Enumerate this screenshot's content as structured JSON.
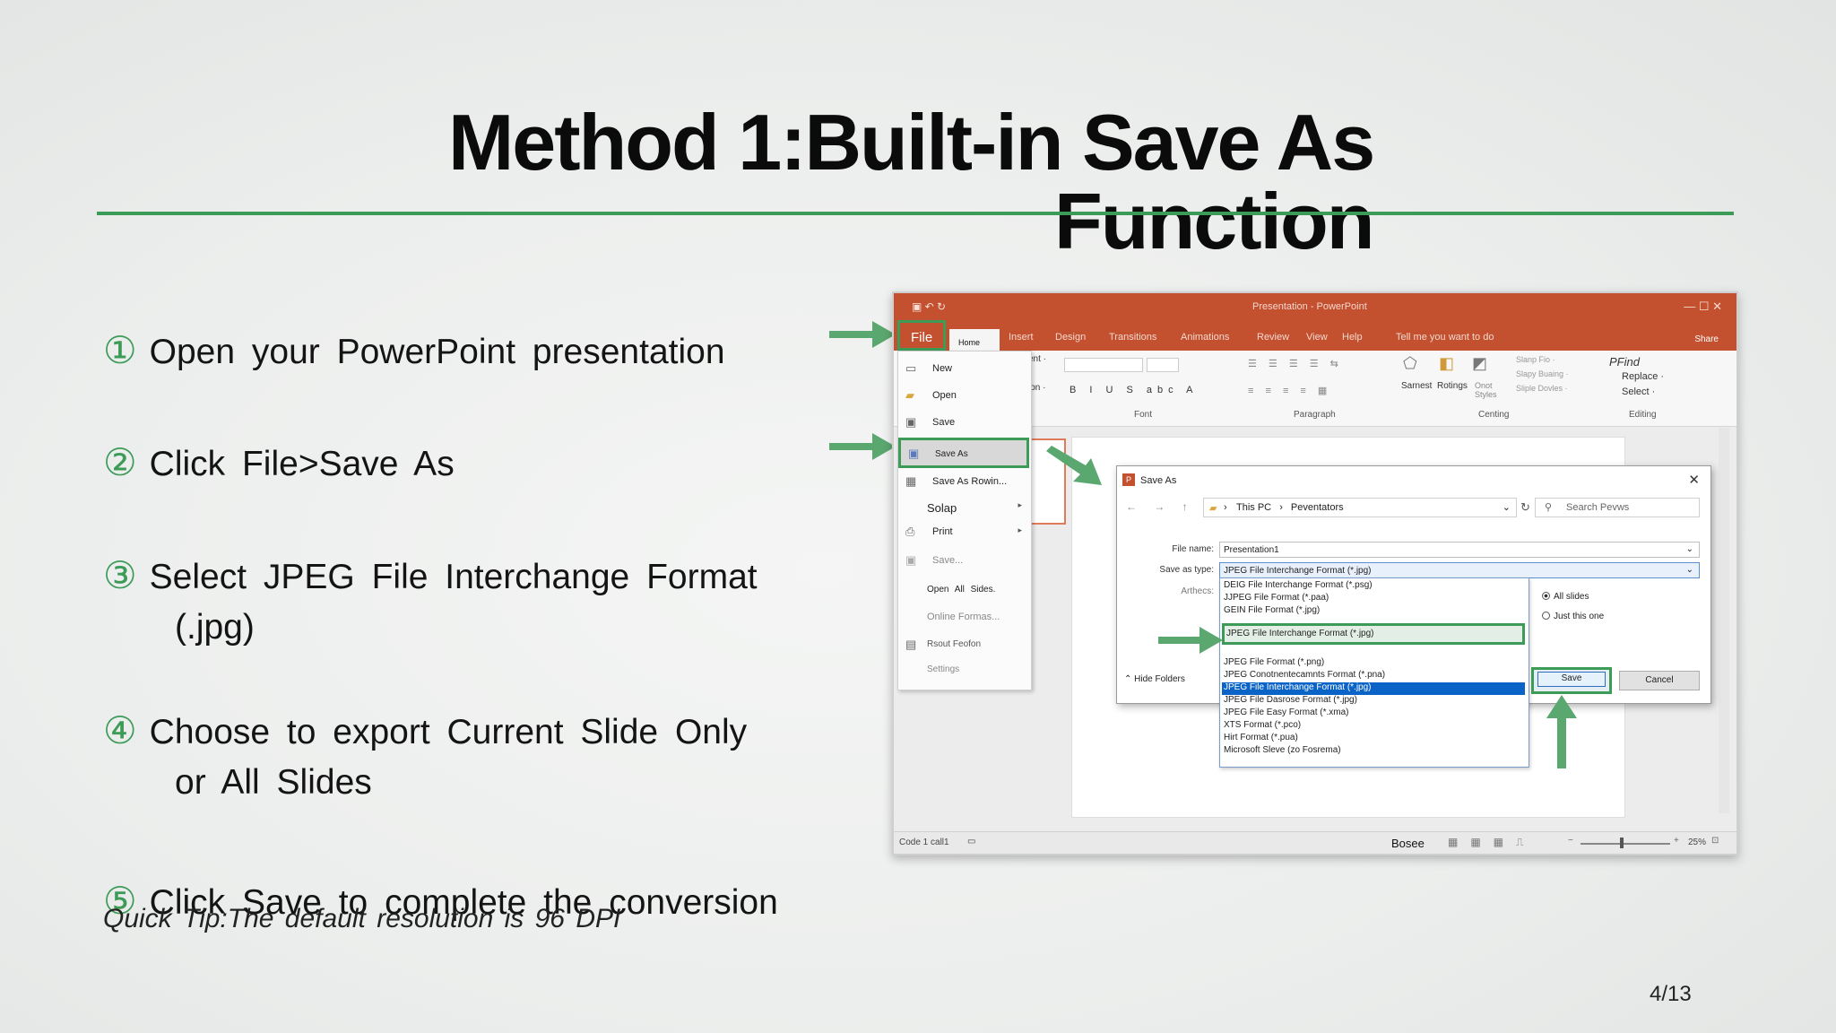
{
  "slide": {
    "title_line1": "Method 1:Built-in Save As",
    "title_line2": "Function",
    "steps": [
      {
        "num": "①",
        "text": "Open your PowerPoint presentation",
        "cont": ""
      },
      {
        "num": "②",
        "text": "Click File>Save As",
        "cont": ""
      },
      {
        "num": "③",
        "text": "Select JPEG File Interchange Format",
        "cont": "(.jpg)"
      },
      {
        "num": "④",
        "text": "Choose to export Current Slide Only",
        "cont": "or All Slides"
      },
      {
        "num": "⑤",
        "text": "Click Save to complete the conversion",
        "cont": ""
      }
    ],
    "tip": "Quick Tip:The default resolution is 96 DPI",
    "page": "4/13",
    "accent_color": "#3d9b58"
  },
  "screenshot": {
    "window_title": "Presentation - PowerPoint",
    "tabs": [
      "Insert",
      "Design",
      "Transitions",
      "Animations",
      "Review",
      "View",
      "Help",
      "Tell me you want to do"
    ],
    "file_tab": "File",
    "home_tab": "Home",
    "share": "Share",
    "ribbon_groups": [
      "Font",
      "Paragraph",
      "Centing",
      "Editing"
    ],
    "ribbon_left": [
      "ent ·",
      "t",
      "ion ·"
    ],
    "drawing_labels": [
      "Sarnest",
      "Rotings",
      "Onot Styles"
    ],
    "quick_styles": [
      "Slanp Fio ·",
      "Slapy Buaing ·",
      "Sliple Dovles ·"
    ],
    "editing_items": [
      "PFind",
      "Replace ·",
      "Select ·"
    ],
    "file_menu": [
      {
        "label": "New",
        "icon": "new-icon"
      },
      {
        "label": "Open",
        "icon": "open-icon"
      },
      {
        "label": "Save",
        "icon": "save-icon"
      },
      {
        "label": "Save As",
        "icon": "save-as-icon"
      },
      {
        "label": "Save As Rowin...",
        "icon": "save-as-icon"
      },
      {
        "label": "Solap",
        "icon": ""
      },
      {
        "label": "Print",
        "icon": "print-icon"
      },
      {
        "label": "Save...",
        "icon": "save-icon"
      },
      {
        "label": "Open All Sides.",
        "icon": ""
      },
      {
        "label": "Online Formas...",
        "icon": ""
      },
      {
        "label": "Rsout Feofon",
        "icon": "share-icon"
      },
      {
        "label": "Settings",
        "icon": ""
      }
    ],
    "dialog": {
      "title": "Save As",
      "breadcrumb": [
        "This PC",
        "Peventators"
      ],
      "search_placeholder": "Search Pevws",
      "file_name_label": "File name:",
      "file_name_value": "Presentation1",
      "save_as_type_label": "Save as type:",
      "save_as_type_value": "JPEG File Interchange Format (*.jpg)",
      "authors_label": "Arthecs:",
      "type_options": [
        "DEIG File Interchange Format (*.psg)",
        "JJPEG File Format (*.paa)",
        "GEIN File Format (*.jpg)",
        "JPEG File Interchange Format (*.jpg)",
        "JPEG File Format (*.png)",
        "JPEG Conotnentecamnts Format (*.pna)",
        "JPEG File Interchange Format (*.jpg)",
        "JPEG File Dasrose Format (*.jpg)",
        "JPEG File Easy Format (*.xma)",
        "XTS Format (*.pco)",
        "Hirt Format (*.pua)",
        "Microsoft Sleve (zo Fosrema)"
      ],
      "radio_all": "All slides",
      "radio_this": "Just this one",
      "hide_folders": "Hide Folders",
      "save_button": "Save",
      "cancel_button": "Cancel"
    },
    "status_left": "Code 1 call1",
    "status_mid": "Bosee",
    "zoom": "25%"
  }
}
